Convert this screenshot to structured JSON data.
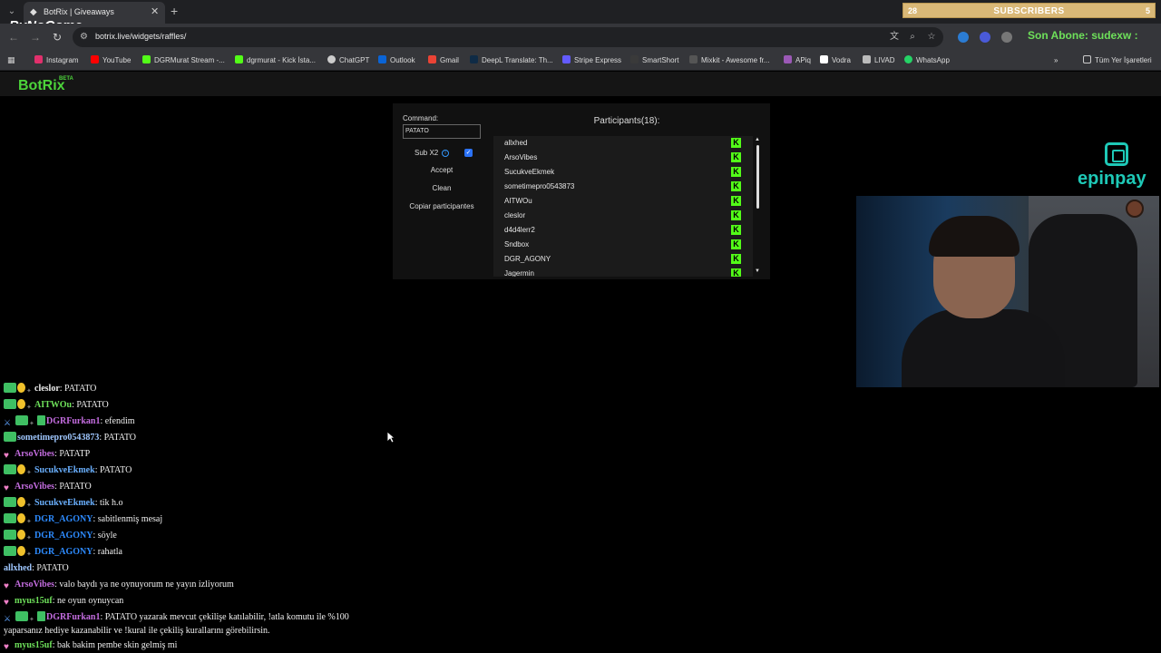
{
  "browser": {
    "tab_title": "BotRix | Giveaways",
    "url": "botrix.live/widgets/raffles/",
    "bookmarks": [
      {
        "label": "Instagram",
        "color": "#e1306c"
      },
      {
        "label": "YouTube",
        "color": "#ff0000"
      },
      {
        "label": "DGRMurat Stream -...",
        "color": "#53fc18"
      },
      {
        "label": "dgrmurat - Kick İsta...",
        "color": "#53fc18"
      },
      {
        "label": "ChatGPT",
        "color": "#cccccc"
      },
      {
        "label": "Outlook",
        "color": "#0a64d6"
      },
      {
        "label": "Gmail",
        "color": "#ea4335"
      },
      {
        "label": "DeepL Translate: Th...",
        "color": "#0f2b46"
      },
      {
        "label": "Stripe Express",
        "color": "#635bff"
      },
      {
        "label": "SmartShort",
        "color": "#3a3a3a"
      },
      {
        "label": "Mixkit - Awesome fr...",
        "color": "#555555"
      },
      {
        "label": "APiq",
        "color": "#9b59b6"
      },
      {
        "label": "Vodra",
        "color": "#ffffff"
      },
      {
        "label": "LIVAD",
        "color": "#bbbbbb"
      },
      {
        "label": "WhatsApp",
        "color": "#25d366"
      }
    ],
    "all_bookmarks": "Tüm Yer İşaretleri"
  },
  "overlay": {
    "subscribers_left": "28",
    "subscribers_label": "SUBSCRIBERS",
    "subscribers_right": "5",
    "stream_logo": "ByNoGame",
    "follow_text": "Son Abone: sudexw :"
  },
  "page": {
    "brand": "BotRix",
    "brand_badge": "BETA",
    "command_label": "Command:",
    "command_value": "PATATO",
    "subx2_label": "Sub X2",
    "subx2_checked": true,
    "buttons": {
      "accept": "Accept",
      "clean": "Clean",
      "copy": "Copiar participantes"
    },
    "participants_title": "Participants(18):",
    "participants": [
      "allxhed",
      "ArsoVibes",
      "SucukveEkmek",
      "sometimepro0543873",
      "AITWOu",
      "cleslor",
      "d4d4lerr2",
      "Sndbox",
      "DGR_AGONY",
      "Jagermin"
    ]
  },
  "sponsor": {
    "name": "epinpay",
    "color": "#1ec9b7"
  },
  "chat": [
    {
      "badges": [
        "sub",
        "gift",
        "gifter"
      ],
      "user": "cleslor",
      "color": "#f0f0f0",
      "text": "PATATO"
    },
    {
      "badges": [
        "sub",
        "gift",
        "gifter"
      ],
      "user": "AITWOu",
      "color": "#6ee05a",
      "text": "PATATO"
    },
    {
      "badges": [
        "sword",
        "sub",
        "gifter",
        "pkg"
      ],
      "user": "DGRFurkan1",
      "color": "#c46de0",
      "text": "efendim"
    },
    {
      "badges": [
        "sub"
      ],
      "user": "sometimepro0543873",
      "color": "#9fc7ff",
      "text": "PATATO"
    },
    {
      "badges": [
        "heart"
      ],
      "user": "ArsoVibes",
      "color": "#c46de0",
      "text": "PATATP"
    },
    {
      "badges": [
        "sub",
        "gift",
        "gifter"
      ],
      "user": "SucukveEkmek",
      "color": "#6ab0ff",
      "text": "PATATO"
    },
    {
      "badges": [
        "heart"
      ],
      "user": "ArsoVibes",
      "color": "#c46de0",
      "text": "PATATO"
    },
    {
      "badges": [
        "sub",
        "gift",
        "gifter"
      ],
      "user": "SucukveEkmek",
      "color": "#6ab0ff",
      "text": "tik h.o"
    },
    {
      "badges": [
        "sub",
        "gift",
        "gifter"
      ],
      "user": "DGR_AGONY",
      "color": "#2d8bff",
      "text": "sabitlenmiş mesaj"
    },
    {
      "badges": [
        "sub",
        "gift",
        "gifter"
      ],
      "user": "DGR_AGONY",
      "color": "#2d8bff",
      "text": "söyle"
    },
    {
      "badges": [
        "sub",
        "gift",
        "gifter"
      ],
      "user": "DGR_AGONY",
      "color": "#2d8bff",
      "text": "rahatla"
    },
    {
      "badges": [],
      "user": "allxhed",
      "color": "#9fc7ff",
      "text": "PATATO"
    },
    {
      "badges": [
        "heart"
      ],
      "user": "ArsoVibes",
      "color": "#c46de0",
      "text": "valo baydı ya ne oynuyorum ne yayın izliyorum"
    },
    {
      "badges": [
        "heart"
      ],
      "user": "myus15uf",
      "color": "#6ee05a",
      "text": "ne oyun oynuycan"
    },
    {
      "badges": [
        "sword",
        "sub",
        "gifter",
        "pkg"
      ],
      "user": "DGRFurkan1",
      "color": "#c46de0",
      "text": "PATATO yazarak mevcut çekilişe katılabilir, !atla komutu ile %100 yaparsanız hediye kazanabilir ve !kural ile çekiliş kurallarını görebilirsin."
    },
    {
      "badges": [
        "heart"
      ],
      "user": "myus15uf",
      "color": "#6ee05a",
      "text": "bak bakim pembe skin gelmiş mi"
    }
  ]
}
